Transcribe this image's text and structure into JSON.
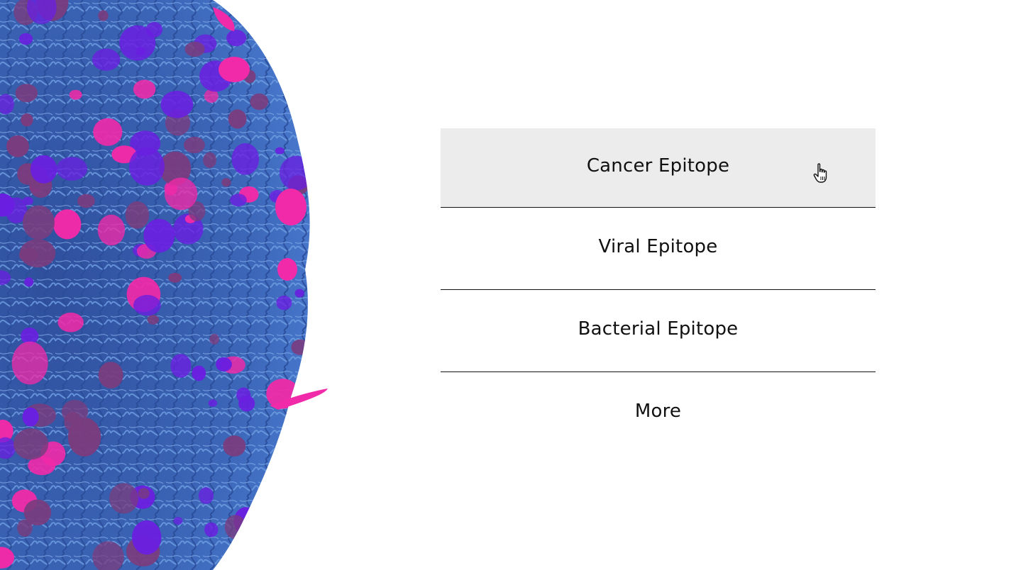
{
  "menu": {
    "items": [
      {
        "label": "Cancer Epitope",
        "state": "hovered"
      },
      {
        "label": "Viral Epitope"
      },
      {
        "label": "Bacterial Epitope"
      },
      {
        "label": "More"
      }
    ],
    "hover_background": "#ececec",
    "divider_color": "#111111"
  },
  "illustration": {
    "icon": "virus-cell-illustration",
    "colors": {
      "strands": "#3a5fb0",
      "purple_blobs": "#6a1fe0",
      "magenta_blobs": "#f02aa8",
      "mauve_clusters": "#7a3c7e"
    }
  },
  "cursor": {
    "icon": "hand-pointer-icon"
  }
}
